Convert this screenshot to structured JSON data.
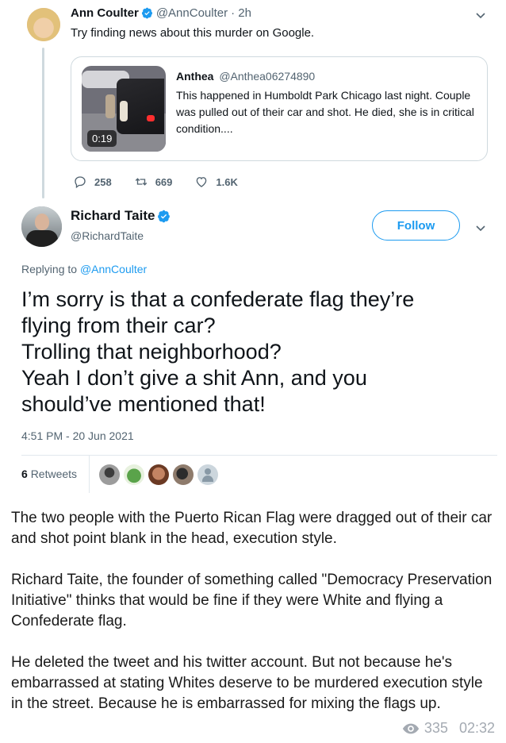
{
  "colors": {
    "accent": "#1d9bf0",
    "text": "#0f1419",
    "muted": "#536471",
    "border": "#cfd9de",
    "meta": "#a4aab2"
  },
  "parent_tweet": {
    "name": "Ann Coulter",
    "handle": "@AnnCoulter",
    "time": "· 2h",
    "text": "Try finding news about this murder on Google.",
    "quote": {
      "name": "Anthea",
      "handle": "@Anthea06274890",
      "text": "This happened in Humboldt Park Chicago last night. Couple was pulled out of their car and shot. He died, she is in critical condition....",
      "video_duration": "0:19"
    },
    "stats": {
      "replies": "258",
      "retweets": "669",
      "likes": "1.6K"
    }
  },
  "main_tweet": {
    "name": "Richard Taite",
    "handle": "@RichardTaite",
    "follow_label": "Follow",
    "replying_prefix": "Replying to",
    "replying_to": "@AnnCoulter",
    "text_lines": [
      "I’m sorry is that a confederate flag they’re",
      "flying from their car?",
      "Trolling that neighborhood?",
      "Yeah I don’t give a shit Ann, and you",
      "should’ve mentioned that!"
    ],
    "timestamp": "4:51 PM - 20 Jun 2021",
    "retweet_count": "6",
    "retweet_label": "Retweets"
  },
  "caption": {
    "paragraphs": [
      "The two people with the Puerto Rican Flag were dragged out of their car and shot point blank in the head, execution style.",
      "Richard Taite, the founder of something called \"Democracy Preservation Initiative\" thinks that would be fine if they were White and flying a Confederate flag.",
      "He deleted the tweet and his twitter account. But not because he's embarrassed at stating Whites deserve to be murdered execution style in the street. Because he is embarrassed for mixing the flags up."
    ]
  },
  "message_meta": {
    "views": "335",
    "time": "02:32"
  }
}
